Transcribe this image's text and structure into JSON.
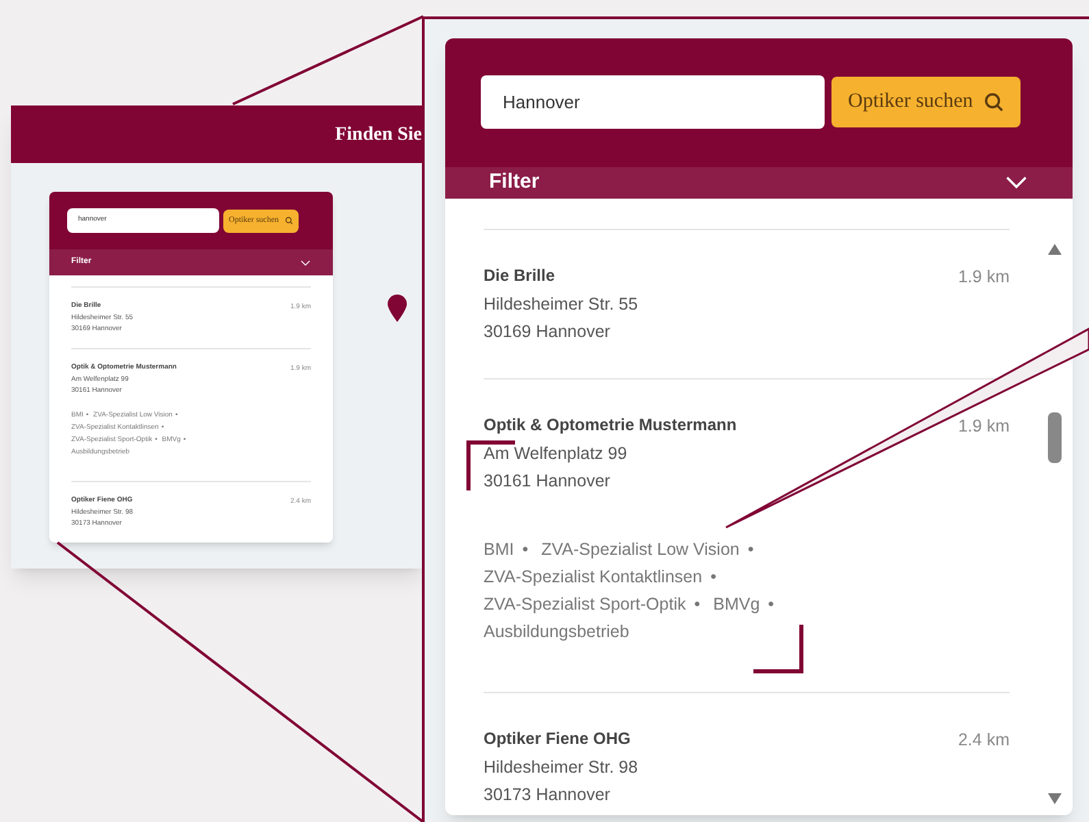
{
  "preview": {
    "header_title": "Finden Sie",
    "search": {
      "value": "hannover",
      "button": "Optiker suchen"
    },
    "filter": {
      "label": "Filter",
      "expanded": false
    },
    "results": [
      {
        "name": "Die Brille",
        "street": "Hildesheimer Str. 55",
        "city": "30169 Hannover",
        "distance": "1.9 km"
      },
      {
        "name": "Optik & Optometrie Mustermann",
        "street": "Am Welfenplatz 99",
        "city": "30161 Hannover",
        "distance": "1.9 km",
        "tags": [
          "BMI",
          "ZVA-Spezialist Low Vision",
          "ZVA-Spezialist Kontaktlinsen",
          "ZVA-Spezialist Sport-Optik",
          "BMVg",
          "Ausbildungsbetrieb"
        ]
      },
      {
        "name": "Optiker Fiene OHG",
        "street": "Hildesheimer Str. 98",
        "city": "30173 Hannover",
        "distance": "2.4 km"
      }
    ]
  },
  "zoom": {
    "search": {
      "value": "Hannover",
      "button": "Optiker suchen"
    },
    "filter": {
      "label": "Filter",
      "expanded": false
    },
    "results": [
      {
        "name": "Die Brille",
        "street": "Hildesheimer Str. 55",
        "city": "30169 Hannover",
        "distance": "1.9 km"
      },
      {
        "name": "Optik & Optometrie Mustermann",
        "street": "Am Welfenplatz 99",
        "city": "30161 Hannover",
        "distance": "1.9 km",
        "tags": [
          "BMI",
          "ZVA-Spezialist Low Vision",
          "ZVA-Spezialist Kontaktlinsen",
          "ZVA-Spezialist Sport-Optik",
          "BMVg",
          "Ausbildungsbetrieb"
        ]
      },
      {
        "name": "Optiker Fiene OHG",
        "street": "Hildesheimer Str. 98",
        "city": "30173 Hannover",
        "distance": "2.4 km"
      }
    ]
  },
  "tag_separator": "•"
}
